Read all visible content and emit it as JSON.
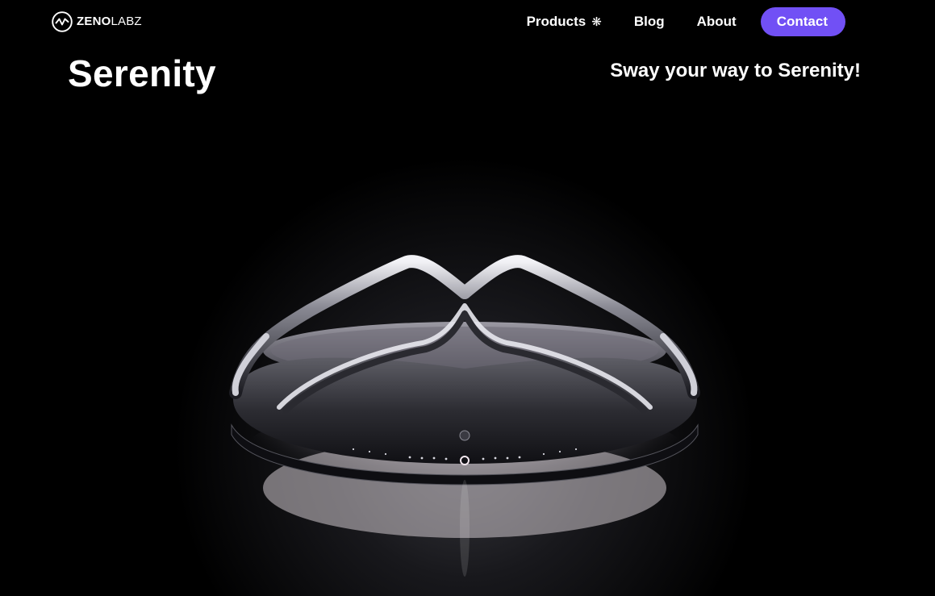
{
  "nav": {
    "brand": {
      "bold": "ZENO",
      "light": "LABZ",
      "icon": "zenolabz-logo-icon"
    },
    "links": [
      {
        "label": "Products",
        "icon": "asterisk-icon",
        "icon_glyph": "❋"
      },
      {
        "label": "Blog"
      },
      {
        "label": "About"
      }
    ],
    "contact_label": "Contact"
  },
  "hero": {
    "title": "Serenity",
    "tagline": "Sway your way to Serenity!",
    "image": "serenity-headband-product-photo"
  },
  "colors": {
    "background": "#000000",
    "text": "#ffffff",
    "accent": "#7150f5"
  }
}
